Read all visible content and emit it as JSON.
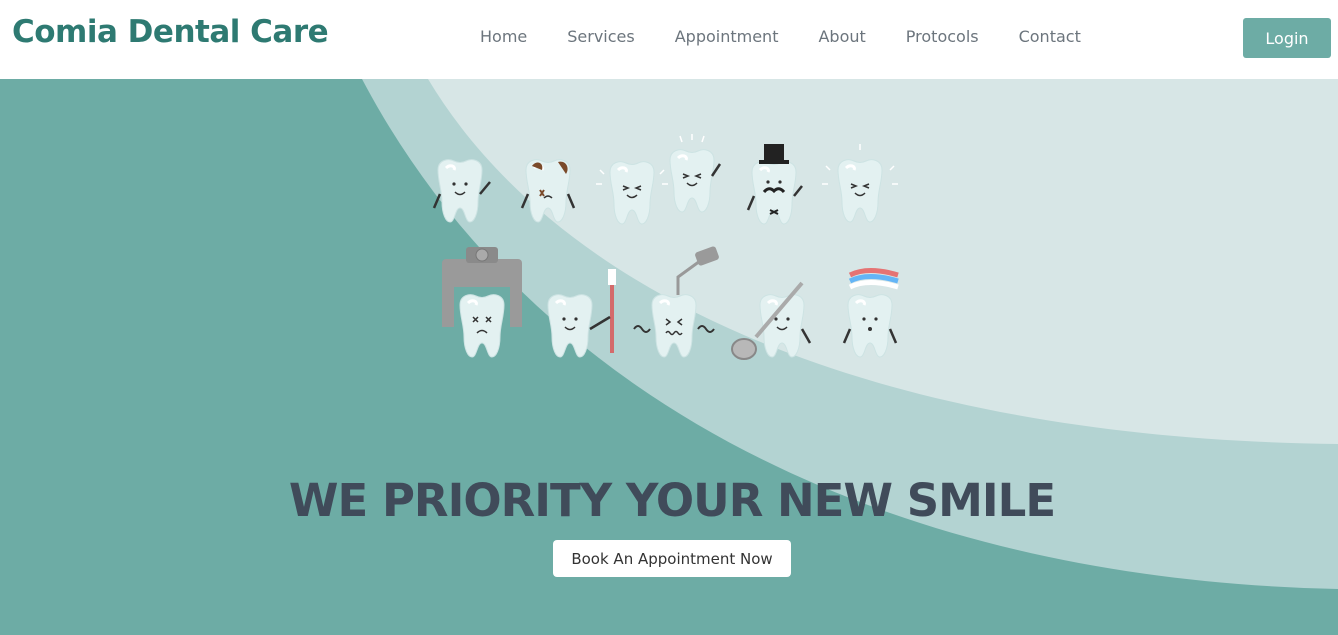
{
  "brand": {
    "name": "Comia Dental Care"
  },
  "nav": {
    "items": [
      {
        "label": "Home"
      },
      {
        "label": "Services"
      },
      {
        "label": "Appointment"
      },
      {
        "label": "About"
      },
      {
        "label": "Protocols"
      },
      {
        "label": "Contact"
      }
    ],
    "login_label": "Login"
  },
  "hero": {
    "headline": "WE PRIORITY YOUR NEW SMILE",
    "cta_label": "Book An Appointment Now",
    "illustration": "cartoon-teeth-characters"
  },
  "colors": {
    "brand": "#2e7a72",
    "primary": "#6daca5",
    "hero_light": "#d7e6e6",
    "hero_mid": "#b3d3d2",
    "headline": "#404b5a"
  }
}
